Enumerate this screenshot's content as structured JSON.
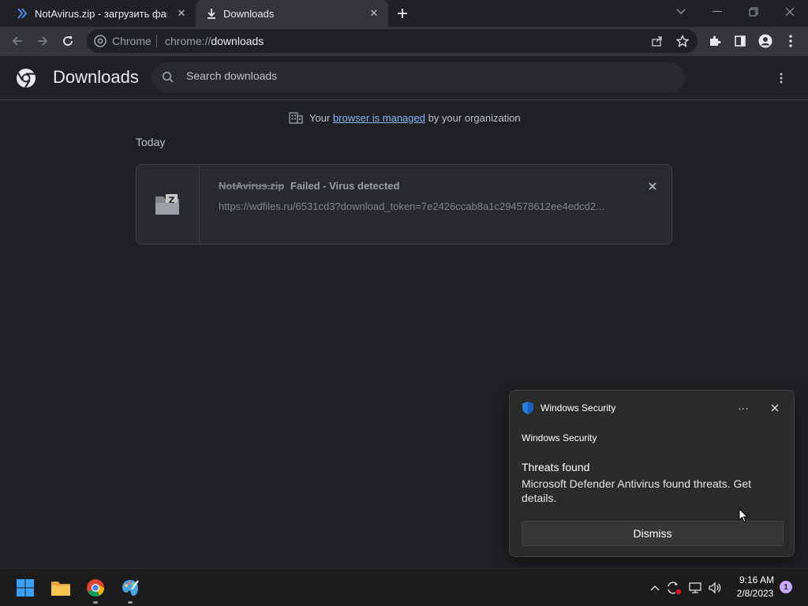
{
  "tabs": [
    {
      "title": "NotAvirus.zip - загрузить файл",
      "icon": "chevrons-icon",
      "active": false
    },
    {
      "title": "Downloads",
      "icon": "download-icon",
      "active": true
    }
  ],
  "toolbar": {
    "origin_label": "Chrome",
    "url_scheme": "chrome://",
    "url_host": "downloads"
  },
  "downloads_page": {
    "title": "Downloads",
    "search_placeholder": "Search downloads",
    "managed_prefix": "Your",
    "managed_link": "browser is managed",
    "managed_suffix": "by your organization",
    "section_label": "Today",
    "item": {
      "filename": "NotAvirus.zip",
      "status": "Failed - Virus detected",
      "url": "https://wdfiles.ru/6531cd3?download_token=7e2426ccab8a1c294578612ee4edcd2..."
    }
  },
  "toast": {
    "app_name": "Windows Security",
    "subtitle": "Windows Security",
    "heading": "Threats found",
    "body": "Microsoft Defender Antivirus found threats. Get details.",
    "dismiss_label": "Dismiss",
    "more_label": "···"
  },
  "taskbar": {
    "time": "9:16 AM",
    "date": "2/8/2023",
    "notification_count": "1"
  },
  "colors": {
    "background": "#202124",
    "toolbar": "#35363a",
    "link": "#8ab4f8",
    "defender_blue": "#2a7de1"
  }
}
